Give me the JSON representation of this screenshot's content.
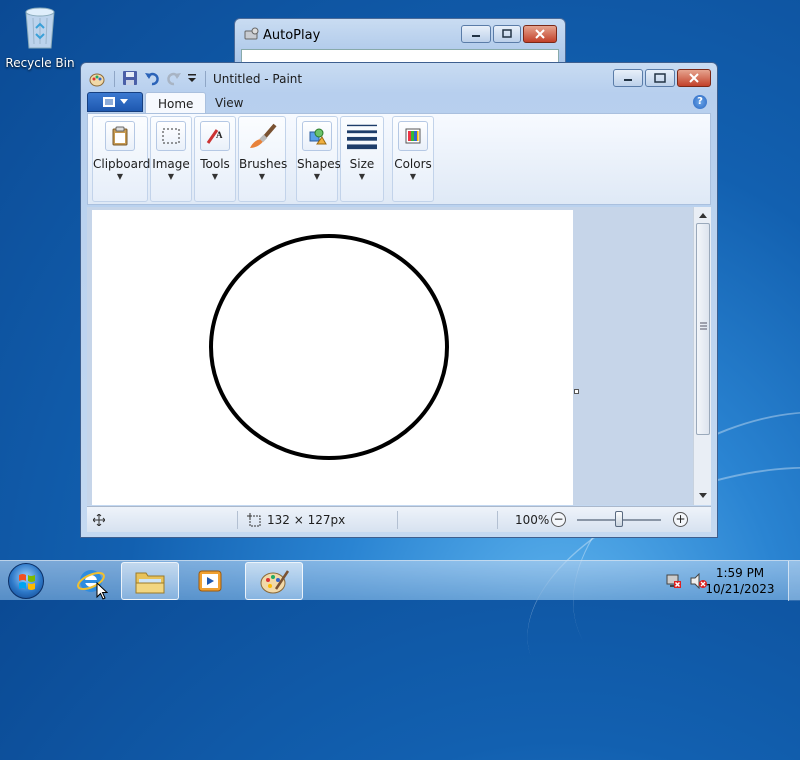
{
  "desktop": {
    "recycle_bin_label": "Recycle Bin"
  },
  "autoplay": {
    "title": "AutoPlay"
  },
  "paint": {
    "title": "Untitled - Paint",
    "tabs": [
      {
        "label": "Home",
        "active": true
      },
      {
        "label": "View",
        "active": false
      }
    ],
    "ribbon_groups": [
      {
        "label": "Clipboard",
        "icon": "clipboard-icon"
      },
      {
        "label": "Image",
        "icon": "select-icon"
      },
      {
        "label": "Tools",
        "icon": "tools-icon"
      },
      {
        "label": "Brushes",
        "icon": "brush-icon"
      },
      {
        "label": "Shapes",
        "icon": "shapes-icon"
      },
      {
        "label": "Size",
        "icon": "size-icon"
      },
      {
        "label": "Colors",
        "icon": "colors-icon"
      }
    ],
    "status": {
      "selection_size": "132 × 127px",
      "zoom": "100%"
    }
  },
  "taskbar": {
    "clock_time": "1:59 PM",
    "clock_date": "10/21/2023",
    "items": [
      "internet-explorer",
      "windows-explorer",
      "media-player",
      "paint"
    ]
  },
  "colors": {
    "accent": "#1e58b0",
    "close": "#c2412a"
  }
}
